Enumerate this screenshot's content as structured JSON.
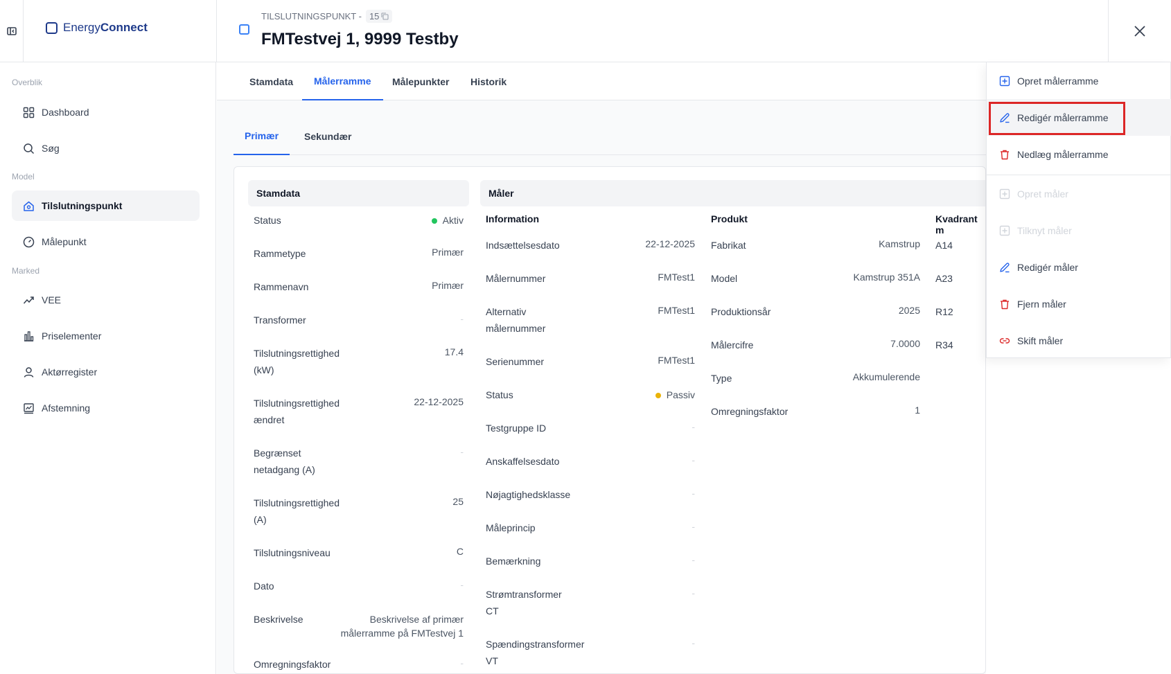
{
  "app": {
    "logo_light": "Energy",
    "logo_bold": "Connect"
  },
  "header": {
    "breadcrumb": "TILSLUTNINGSPUNKT -",
    "id": "15",
    "title": "FMTestvej 1, 9999 Testby"
  },
  "sidebar": {
    "sections": [
      "Overblik",
      "Model",
      "Marked"
    ],
    "items": [
      {
        "label": "Dashboard",
        "icon": "grid-icon"
      },
      {
        "label": "Søg",
        "icon": "search-icon"
      },
      {
        "label": "Tilslutningspunkt",
        "icon": "house-icon",
        "active": true
      },
      {
        "label": "Målepunkt",
        "icon": "gauge-icon"
      },
      {
        "label": "VEE",
        "icon": "trend-icon"
      },
      {
        "label": "Priselementer",
        "icon": "bar-chart-icon"
      },
      {
        "label": "Aktørregister",
        "icon": "user-icon"
      },
      {
        "label": "Afstemning",
        "icon": "chart-box-icon"
      }
    ]
  },
  "tabs": [
    "Stamdata",
    "Målerramme",
    "Målepunkter",
    "Historik"
  ],
  "active_tab": "Målerramme",
  "subtabs": [
    "Primær",
    "Sekundær"
  ],
  "active_subtab": "Primær",
  "stamdata": {
    "title": "Stamdata",
    "rows": [
      {
        "label": "Status",
        "value": "Aktiv",
        "status_color": "#22c55e"
      },
      {
        "label": "Rammetype",
        "value": "Primær"
      },
      {
        "label": "Rammenavn",
        "value": "Primær"
      },
      {
        "label": "Transformer",
        "value": "-"
      },
      {
        "label": "Tilslutningsrettighed (kW)",
        "value": "17.4"
      },
      {
        "label": "Tilslutningsrettighed ændret",
        "value": "22-12-2025"
      },
      {
        "label": "Begrænset netadgang (A)",
        "value": "-"
      },
      {
        "label": "Tilslutningsrettighed (A)",
        "value": "25"
      },
      {
        "label": "Tilslutningsniveau",
        "value": "C"
      },
      {
        "label": "Dato",
        "value": "-"
      },
      {
        "label": "Beskrivelse",
        "value": "Beskrivelse af primær målerramme på FMTestvej 1"
      },
      {
        "label": "Omregningsfaktor",
        "value": "-"
      }
    ]
  },
  "maler": {
    "title": "Måler",
    "information": {
      "heading": "Information",
      "rows": [
        {
          "label": "Indsættelsesdato",
          "value": "22-12-2025"
        },
        {
          "label": "Målernummer",
          "value": "FMTest1"
        },
        {
          "label": "Alternativ målernummer",
          "value": "FMTest1"
        },
        {
          "label": "Serienummer",
          "value": "FMTest1"
        },
        {
          "label": "Status",
          "value": "Passiv",
          "status_color": "#eab308"
        },
        {
          "label": "Testgruppe ID",
          "value": "-"
        },
        {
          "label": "Anskaffelsesdato",
          "value": "-"
        },
        {
          "label": "Nøjagtighedsklasse",
          "value": "-"
        },
        {
          "label": "Måleprincip",
          "value": "-"
        },
        {
          "label": "Bemærkning",
          "value": "-"
        },
        {
          "label": "Strømtransformer CT",
          "value": "-"
        },
        {
          "label": "Spændingstransformer VT",
          "value": "-"
        }
      ]
    },
    "produkt": {
      "heading": "Produkt",
      "rows": [
        {
          "label": "Fabrikat",
          "value": "Kamstrup"
        },
        {
          "label": "Model",
          "value": "Kamstrup 351A"
        },
        {
          "label": "Produktionsår",
          "value": "2025"
        },
        {
          "label": "Målercifre",
          "value": "7.0000"
        },
        {
          "label": "Type",
          "value": "Akkumulerende"
        },
        {
          "label": "Omregningsfaktor",
          "value": "1"
        }
      ]
    },
    "kvadrant": {
      "heading": "Kvadrant m",
      "rows": [
        "A14",
        "A23",
        "R12",
        "R34"
      ]
    }
  },
  "menu": {
    "items": [
      {
        "label": "Opret målerramme",
        "icon": "plus-square-icon",
        "state": "normal"
      },
      {
        "label": "Redigér målerramme",
        "icon": "pencil-icon",
        "state": "hovered"
      },
      {
        "label": "Nedlæg målerramme",
        "icon": "trash-icon",
        "state": "normal"
      },
      {
        "label": "Opret måler",
        "icon": "plus-square-icon",
        "state": "disabled"
      },
      {
        "label": "Tilknyt måler",
        "icon": "plus-square-icon",
        "state": "disabled"
      },
      {
        "label": "Redigér måler",
        "icon": "pencil-icon",
        "state": "normal"
      },
      {
        "label": "Fjern måler",
        "icon": "trash-icon",
        "state": "normal"
      },
      {
        "label": "Skift måler",
        "icon": "link-icon",
        "state": "normal"
      }
    ]
  },
  "colors": {
    "accent": "#2563eb",
    "danger": "#dc2626",
    "brand": "#1e3a8a"
  }
}
